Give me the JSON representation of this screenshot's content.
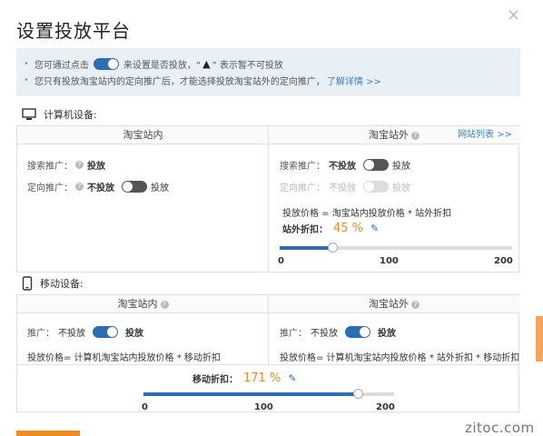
{
  "dialog": {
    "title": "设置投放平台",
    "close": "×"
  },
  "notice": {
    "line1_pre": "您可通过点击",
    "line1_post": "来设置是否投放，“",
    "line1_warn": "▲",
    "line1_end": "” 表示暂不可投放",
    "line2": "您只有投放淘宝站内的定向推广后，才能选择投放淘宝站外的定向推广，",
    "line2_link": "了解详情 >>",
    "bullet": "•"
  },
  "computer": {
    "heading": "计算机设备:",
    "inside": {
      "header": "淘宝站内",
      "search_label": "搜索推广：",
      "search_status": "投放",
      "targeted_label": "定向推广：",
      "targeted_off": "不投放",
      "targeted_on": "投放",
      "targeted_state": "off"
    },
    "outside": {
      "header": "淘宝站外",
      "link": "网站列表 >>",
      "search_label": "搜索推广：",
      "search_off": "不投放",
      "search_on": "投放",
      "search_state": "off",
      "targeted_label": "定向推广：",
      "targeted_off": "不投放",
      "targeted_on": "投放",
      "targeted_state": "disabled",
      "formula": "投放价格 = 淘宝站内投放价格 * 站外折扣",
      "discount_label": "站外折扣：",
      "discount_value": "45 %",
      "slider_value": 45,
      "ticks": [
        "0",
        "100",
        "200"
      ]
    }
  },
  "mobile": {
    "heading": "移动设备:",
    "inside": {
      "header": "淘宝站内",
      "promo_label": "推广：",
      "promo_off": "不投放",
      "promo_on": "投放",
      "promo_state": "on",
      "formula": "投放价格= 计算机淘宝站内投放价格 * 移动折扣"
    },
    "outside": {
      "header": "淘宝站外",
      "promo_label": "推广：",
      "promo_off": "不投放",
      "promo_on": "投放",
      "promo_state": "on",
      "formula": "投放价格= 计算机淘宝站内投放价格 * 站外折扣 * 移动折扣"
    },
    "discount_label": "移动折扣：",
    "discount_value": "171 %",
    "slider_value": 171,
    "ticks": [
      "0",
      "100",
      "200"
    ]
  },
  "watermark": "zitoc.com",
  "colors": {
    "accent": "#2d6db5",
    "orange": "#f08a24",
    "notice_bg": "#e8f0f6",
    "link": "#3c7fc6"
  }
}
